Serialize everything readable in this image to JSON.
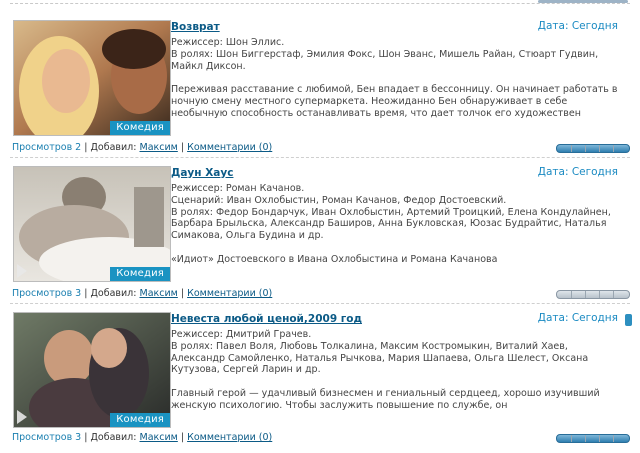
{
  "entries": [
    {
      "title": "Возврат",
      "date_label": "Дата: Сегодня",
      "genre": "Комедия",
      "lines": [
        "Режиссер: Шон Эллис.",
        "В ролях: Шон Биггерстаф, Эмилия Фокс, Шон Эванс, Мишель Райан, Стюарт Гудвин,",
        "Майкл Диксон."
      ],
      "desc": [
        "Переживая расставание с любимой, Бен впадает в бессонницу. Он начинает работать в",
        "ночную смену местного супермаркета. Неожиданно Бен обнаруживает в себе",
        "необычную способность останавливать время, что дает толчок его художествен"
      ],
      "views": "Просмотров 2",
      "added_label": "Добавил:",
      "author": "Максим",
      "comments": "Комментарии (0)"
    },
    {
      "title": "Даун Хаус",
      "date_label": "Дата: Сегодня",
      "genre": "Комедия",
      "lines": [
        "Режиссер: Роман Качанов.",
        "Сценарий: Иван Охлобыстин, Роман Качанов, Федор Достоевский.",
        "В ролях: Федор Бондарчук, Иван Охлобыстин, Артемий Троицкий, Елена Кондулайнен,",
        "Барбара Брыльска, Александр Баширов, Анна Букловская, Юозас Будрайтис, Наталья",
        "Симакова, Ольга Будина и др."
      ],
      "desc": [
        "«Идиот» Достоевского в Ивана Охлобыстина и Романа Качанова"
      ],
      "views": "Просмотров 3",
      "added_label": "Добавил:",
      "author": "Максим",
      "comments": "Комментарии (0)"
    },
    {
      "title": "Невеста любой ценой,2009 год",
      "date_label": "Дата: Сегодня",
      "genre": "Комедия",
      "lines": [
        "Режиссер: Дмитрий Грачев.",
        "В ролях: Павел Воля, Любовь Толкалина, Максим Костромыкин, Виталий Хаев,",
        "Александр Самойленко, Наталья Рычкова, Мария Шапаева, Ольга Шелест, Оксана",
        "Кутузова, Сергей Ларин и др."
      ],
      "desc": [
        "Главный герой — удачливый бизнесмен и гениальный сердцеед, хорошо изучивший",
        "женскую психологию. Чтобы заслужить повышение по службе, он"
      ],
      "views": "Просмотров 3",
      "added_label": "Добавил:",
      "author": "Максим",
      "comments": "Комментарии (0)"
    }
  ],
  "colors": {
    "accent": "#1a93c2",
    "link": "#0b5a86"
  }
}
